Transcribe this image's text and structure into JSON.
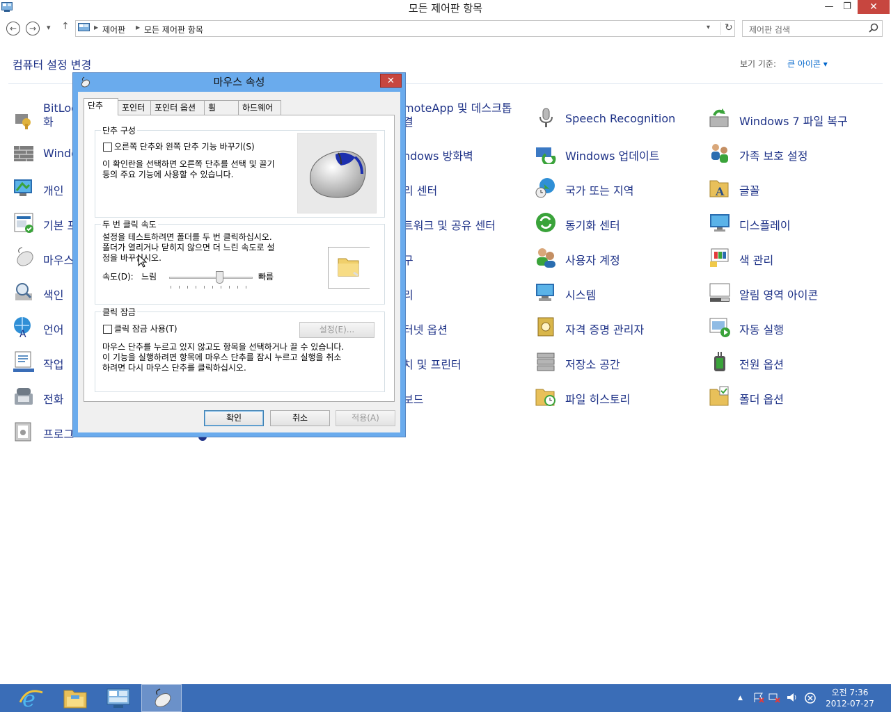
{
  "window": {
    "title": "모든 제어판 항목",
    "min": "—",
    "max": "❐",
    "close": "✕"
  },
  "nav": {
    "back": "←",
    "forward": "→",
    "recent": "▾",
    "up": "↑",
    "breadcrumb": [
      "제어판",
      "모든 제어판 항목"
    ],
    "search_placeholder": "제어판 검색"
  },
  "header": {
    "title": "컴퓨터 설정 변경",
    "view_by_label": "보기 기준:",
    "view_by_value": "큰 아이콘 ▾"
  },
  "items": {
    "col1": [
      "BitLocker 드라이브 암호화",
      "Windows Defender",
      "개인 설정",
      "기본 프로그램",
      "마우스",
      "색인 옵션",
      "언어",
      "작업 표시줄",
      "전화 및 모뎀",
      "프로그램 및 기능"
    ],
    "col3": [
      "RemoteApp 및 데스크톱 연결",
      "Windows 방화벽",
      "관리 센터",
      "네트워크 및 공유 센터",
      "도구",
      "관리",
      "인터넷 옵션",
      "장치 및 프린터",
      "키보드"
    ],
    "col3_visible": [
      "moteApp 및 데스크톱",
      "결",
      "ndows 방화벽",
      "리 센터",
      "트워크 및 공유 센터",
      "구",
      "리",
      "터넷 옵션",
      "치 및 프린터",
      "보드"
    ],
    "col4": [
      "Speech Recognition",
      "Windows 업데이트",
      "국가 또는 지역",
      "동기화 센터",
      "사용자 계정",
      "시스템",
      "자격 증명 관리자",
      "저장소 공간",
      "파일 히스토리"
    ],
    "col5": [
      "Windows 7 파일 복구",
      "가족 보호 설정",
      "글꼴",
      "디스플레이",
      "색 관리",
      "알림 영역 아이콘",
      "자동 실행",
      "전원 옵션",
      "폴더 옵션"
    ],
    "col1_visible": [
      "BitLoc",
      "화",
      "Windo",
      "개인 ",
      "기본 프",
      "마우스",
      "색인 ",
      "언어",
      "작업 ",
      "전화 ",
      "프로그"
    ]
  },
  "dialog": {
    "title": "마우스 속성",
    "close": "✕",
    "tabs": [
      "단추",
      "포인터",
      "포인터 옵션",
      "휠",
      "하드웨어"
    ],
    "button_config": {
      "legend": "단추 구성",
      "checkbox_label": "오른쪽 단추와 왼쪽 단추 기능 바꾸기(S)",
      "desc": [
        "이 확인란을 선택하면 오른쪽 단추를 선택 및 끌기",
        "등의 주요 기능에 사용할 수 있습니다."
      ]
    },
    "double_click": {
      "legend": "두 번 클릭 속도",
      "desc": [
        "설정을 테스트하려면 폴더를 두 번 클릭하십시오.",
        "폴더가 열리거나 닫히지 않으면 더 느린 속도로 설",
        "정을 바꾸십시오."
      ],
      "speed_label": "속도(D):",
      "slow": "느림",
      "fast": "빠름",
      "speed_value": 0.6
    },
    "click_lock": {
      "legend": "클릭 잠금",
      "checkbox_label": "클릭 잠금 사용(T)",
      "settings_button": "설정(E)...",
      "desc": [
        "마우스 단추를 누르고 있지 않고도 항목을 선택하거나 끌 수 있습니다.",
        "이 기능을 실행하려면 항목에 마우스 단추를 잠시 누르고 실행을 취소",
        "하려면 다시 마우스 단추를 클릭하십시오."
      ]
    },
    "buttons": {
      "ok": "확인",
      "cancel": "취소",
      "apply": "적용(A)"
    }
  },
  "taskbar": {
    "time": "오전 7:36",
    "date": "2012-07-27",
    "tray_up": "▲"
  },
  "colors": {
    "link": "#1e3287",
    "dialog_frame": "#6aabed",
    "taskbar": "#3a6db7",
    "close_red": "#c7463f"
  }
}
